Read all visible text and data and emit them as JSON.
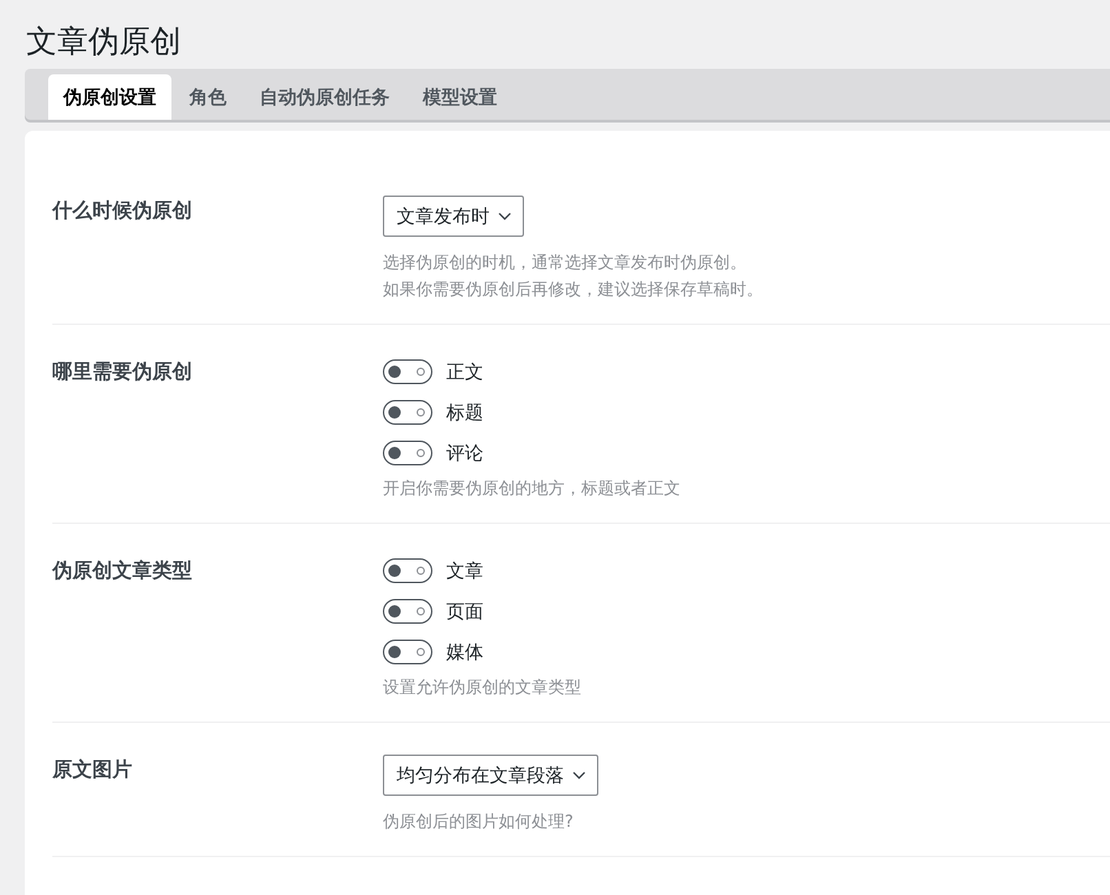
{
  "page_title": "文章伪原创",
  "tabs": [
    {
      "label": "伪原创设置",
      "selected": true
    },
    {
      "label": "角色",
      "selected": false
    },
    {
      "label": "自动伪原创任务",
      "selected": false
    },
    {
      "label": "模型设置",
      "selected": false
    }
  ],
  "settings": [
    {
      "kind": "select",
      "label": "什么时候伪原创",
      "value": "文章发布时",
      "help": [
        "选择伪原创的时机，通常选择文章发布时伪原创。",
        "如果你需要伪原创后再修改，建议选择保存草稿时。"
      ]
    },
    {
      "kind": "toggles",
      "label": "哪里需要伪原创",
      "options": [
        {
          "label": "正文",
          "on": false
        },
        {
          "label": "标题",
          "on": false
        },
        {
          "label": "评论",
          "on": false
        }
      ],
      "help": [
        "开启你需要伪原创的地方，标题或者正文"
      ]
    },
    {
      "kind": "toggles",
      "label": "伪原创文章类型",
      "options": [
        {
          "label": "文章",
          "on": false
        },
        {
          "label": "页面",
          "on": false
        },
        {
          "label": "媒体",
          "on": false
        }
      ],
      "help": [
        "设置允许伪原创的文章类型"
      ]
    },
    {
      "kind": "select",
      "label": "原文图片",
      "value": "均匀分布在文章段落",
      "help": [
        "伪原创后的图片如何处理?"
      ]
    }
  ]
}
